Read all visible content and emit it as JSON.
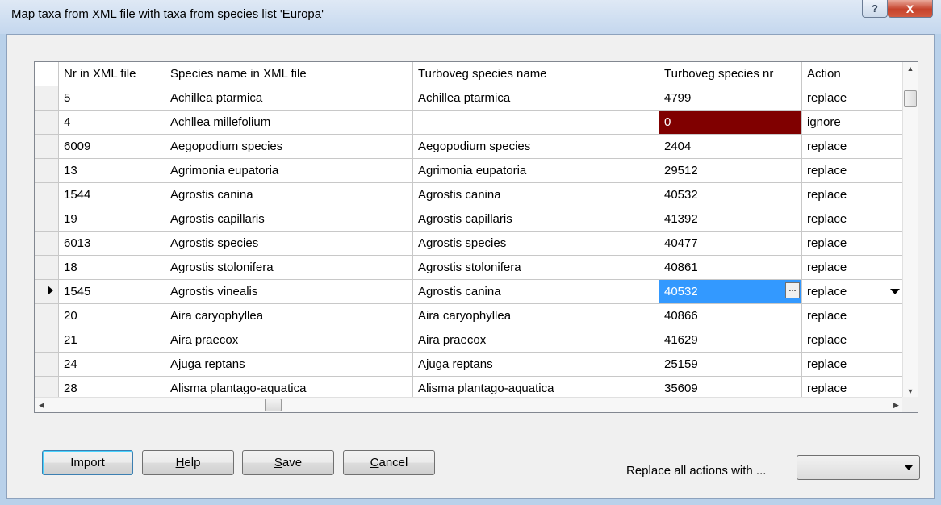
{
  "window": {
    "title": "Map taxa from XML file with taxa from species list 'Europa'",
    "help_glyph": "?",
    "close_glyph": "X"
  },
  "grid": {
    "columns": [
      "Nr in XML file",
      "Species name in XML file",
      "Turboveg species name",
      "Turboveg species nr",
      "Action"
    ],
    "current_row_index": 8,
    "rows": [
      {
        "nr": "5",
        "xml_name": "Achillea ptarmica",
        "tv_name": "Achillea ptarmica",
        "tv_nr": "4799",
        "action": "replace"
      },
      {
        "nr": "4",
        "xml_name": "Achllea millefolium",
        "tv_name": "",
        "tv_nr": "0",
        "action": "ignore"
      },
      {
        "nr": "6009",
        "xml_name": "Aegopodium species",
        "tv_name": "Aegopodium species",
        "tv_nr": "2404",
        "action": "replace"
      },
      {
        "nr": "13",
        "xml_name": "Agrimonia eupatoria",
        "tv_name": "Agrimonia eupatoria",
        "tv_nr": "29512",
        "action": "replace"
      },
      {
        "nr": "1544",
        "xml_name": "Agrostis canina",
        "tv_name": "Agrostis canina",
        "tv_nr": "40532",
        "action": "replace"
      },
      {
        "nr": "19",
        "xml_name": "Agrostis capillaris",
        "tv_name": "Agrostis capillaris",
        "tv_nr": "41392",
        "action": "replace"
      },
      {
        "nr": "6013",
        "xml_name": "Agrostis species",
        "tv_name": "Agrostis species",
        "tv_nr": "40477",
        "action": "replace"
      },
      {
        "nr": "18",
        "xml_name": "Agrostis stolonifera",
        "tv_name": "Agrostis stolonifera",
        "tv_nr": "40861",
        "action": "replace"
      },
      {
        "nr": "1545",
        "xml_name": "Agrostis vinealis",
        "tv_name": "Agrostis canina",
        "tv_nr": "40532",
        "action": "replace"
      },
      {
        "nr": "20",
        "xml_name": "Aira caryophyllea",
        "tv_name": "Aira caryophyllea",
        "tv_nr": "40866",
        "action": "replace"
      },
      {
        "nr": "21",
        "xml_name": "Aira praecox",
        "tv_name": "Aira praecox",
        "tv_nr": "41629",
        "action": "replace"
      },
      {
        "nr": "24",
        "xml_name": "Ajuga reptans",
        "tv_name": "Ajuga reptans",
        "tv_nr": "25159",
        "action": "replace"
      },
      {
        "nr": "28",
        "xml_name": "Alisma plantago-aquatica",
        "tv_name": "Alisma plantago-aquatica",
        "tv_nr": "35609",
        "action": "replace"
      }
    ],
    "ellipsis_glyph": "..."
  },
  "buttons": {
    "import": "Import",
    "help_pre": "",
    "help_u": "H",
    "help_post": "elp",
    "save_pre": "",
    "save_u": "S",
    "save_post": "ave",
    "cancel_pre": "",
    "cancel_u": "C",
    "cancel_post": "ancel"
  },
  "replace_all": {
    "label": "Replace all actions with ...",
    "value": ""
  },
  "colors": {
    "error_cell": "#800000",
    "selected_cell": "#3399ff"
  }
}
